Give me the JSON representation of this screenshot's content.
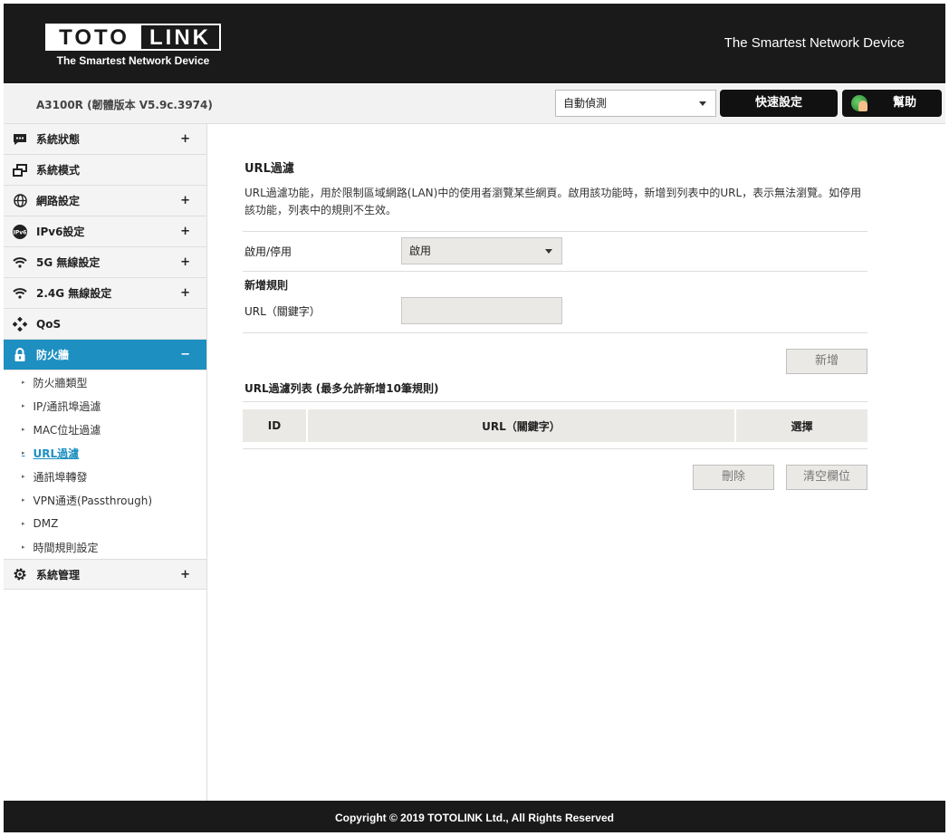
{
  "header": {
    "logo_left": "TOTO",
    "logo_right": "LINK",
    "logo_tagline": "The Smartest Network Device",
    "slogan": "The Smartest Network Device"
  },
  "subheader": {
    "version": "A3100R (韌體版本 V5.9c.3974)",
    "language": "自動偵測",
    "quick_setup": "快速設定",
    "help": "幫助"
  },
  "sidebar": {
    "items": [
      {
        "label": "系統狀態",
        "icon": "chat-bubble-icon",
        "expand": "+"
      },
      {
        "label": "系統模式",
        "icon": "windows-icon",
        "expand": ""
      },
      {
        "label": "網路設定",
        "icon": "globe-icon",
        "expand": "+"
      },
      {
        "label": "IPv6設定",
        "icon": "ipv6-icon",
        "expand": "+"
      },
      {
        "label": "5G 無線設定",
        "icon": "wifi-icon",
        "expand": "+"
      },
      {
        "label": "2.4G 無線設定",
        "icon": "wifi-icon",
        "expand": "+"
      },
      {
        "label": "QoS",
        "icon": "qos-icon",
        "expand": ""
      },
      {
        "label": "防火牆",
        "icon": "lock-icon",
        "expand": "−"
      }
    ],
    "firewall_sub": [
      "防火牆類型",
      "IP/通訊埠過濾",
      "MAC位址過濾",
      "URL過濾",
      "通訊埠轉發",
      "VPN通透(Passthrough)",
      "DMZ",
      "時間規則設定"
    ],
    "last_item": {
      "label": "系統管理",
      "icon": "gear-icon",
      "expand": "+"
    },
    "active_color": "#1d8fc1"
  },
  "content": {
    "title": "URL過濾",
    "description": "URL過濾功能，用於限制區域網路(LAN)中的使用者瀏覽某些網頁。啟用該功能時，新增到列表中的URL，表示無法瀏覽。如停用該功能，列表中的規則不生效。",
    "enable_label": "啟用/停用",
    "enable_value": "啟用",
    "add_rule_heading": "新增規則",
    "url_label": "URL（關鍵字）",
    "url_value": "",
    "add_button": "新增",
    "list_heading": "URL過濾列表 (最多允許新增10筆規則)",
    "table_headers": [
      "ID",
      "URL（關鍵字）",
      "選擇"
    ],
    "delete_button": "刪除",
    "clear_button": "清空欄位"
  },
  "footer": {
    "copyright": "Copyright © 2019 TOTOLINK Ltd., All Rights Reserved"
  }
}
